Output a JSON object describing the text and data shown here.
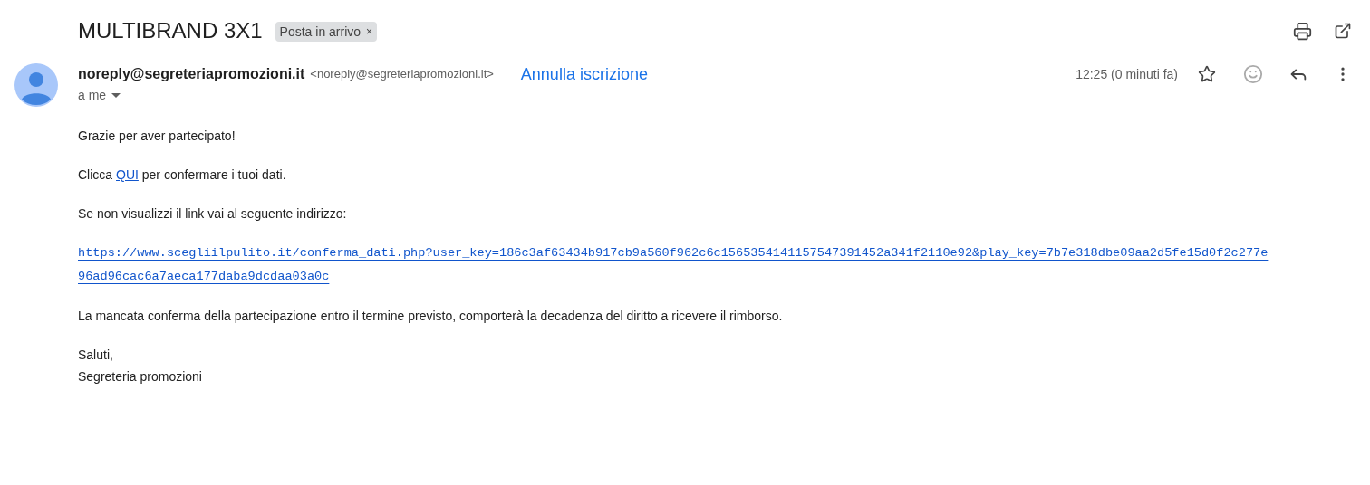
{
  "subject": "MULTIBRAND 3X1",
  "label": {
    "text": "Posta in arrivo",
    "remove": "×"
  },
  "sender": {
    "name": "noreply@segreteriapromozioni.it",
    "address": "<noreply@segreteriapromozioni.it>",
    "unsubscribe": "Annulla iscrizione",
    "recipient": "a me",
    "time": "12:25 (0 minuti fa)",
    "starred": false
  },
  "body": {
    "greeting": "Grazie per aver partecipato!",
    "confirm": {
      "before": "Clicca ",
      "link": "QUI",
      "after": " per confermare i tuoi dati."
    },
    "fallback": "Se non visualizzi il link vai al seguente indirizzo:",
    "url_lines": [
      "https://www.scegliilpulito.it/conferma_dati.php?user_key=186c3af63434b917cb9a560f962c6c1565354141157547391452a341f2110e92&play_key=7b7e318dbe09aa2d5fe15d0f2c277e",
      "96ad96cac6a7aeca177daba9dcdaa03a0c"
    ],
    "warning": "La mancata conferma della partecipazione entro il termine previsto, comporterà la decadenza del diritto a ricevere il rimborso.",
    "signoff": [
      "Saluti,",
      "Segreteria promozioni"
    ]
  }
}
